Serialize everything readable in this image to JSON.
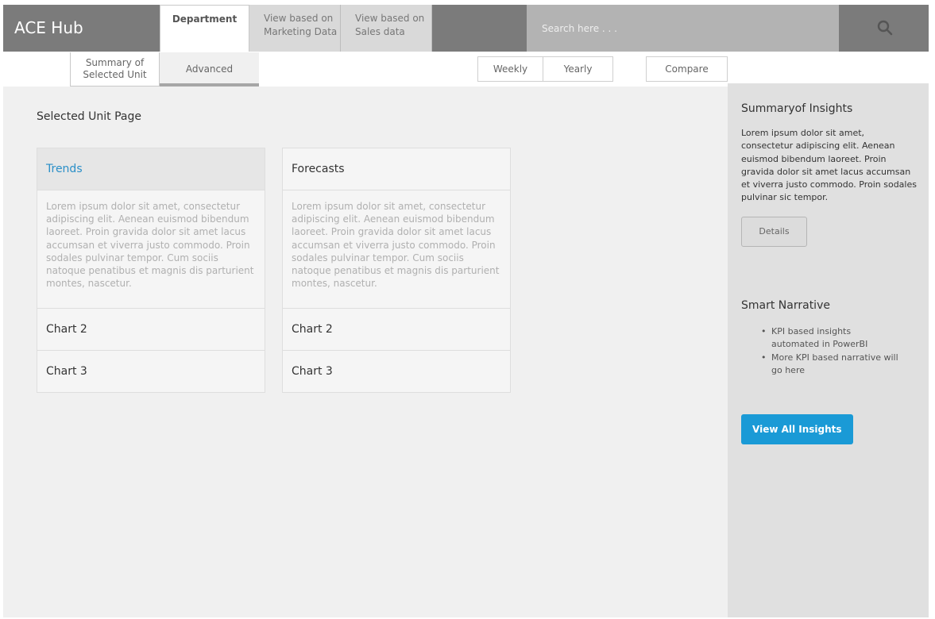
{
  "app": {
    "title": "ACE Hub"
  },
  "tabs": {
    "department": "Department",
    "marketing_line1": "View based on",
    "marketing_line2": "Marketing Data",
    "sales_line1": "View based on",
    "sales_line2": "Sales data"
  },
  "search": {
    "placeholder": "Search here . . ."
  },
  "subtabs": {
    "summary_line1": "Summary of",
    "summary_line2": "Selected Unit",
    "advanced": "Advanced"
  },
  "filters": {
    "weekly": "Weekly",
    "yearly": "Yearly",
    "compare": "Compare"
  },
  "main": {
    "page_title": "Selected Unit Page",
    "cards": [
      {
        "header": "Trends",
        "body": "Lorem ipsum dolor sit amet, consectetur adipiscing elit. Aenean euismod bibendum laoreet. Proin gravida dolor sit amet lacus accumsan et viverra justo commodo. Proin sodales pulvinar tempor. Cum sociis natoque penatibus et magnis dis parturient montes, nascetur.",
        "rows": [
          "Chart 2",
          "Chart 3"
        ]
      },
      {
        "header": "Forecasts",
        "body": "Lorem ipsum dolor sit amet, consectetur adipiscing elit. Aenean euismod bibendum laoreet. Proin gravida dolor sit amet lacus accumsan et viverra justo commodo. Proin sodales pulvinar tempor. Cum sociis natoque penatibus et magnis dis parturient montes, nascetur.",
        "rows": [
          "Chart 2",
          "Chart 3"
        ]
      }
    ]
  },
  "panel": {
    "summary_title": "Summaryof Insights",
    "summary_text": "Lorem ipsum dolor sit amet, consectetur adipiscing elit. Aenean euismod bibendum laoreet. Proin gravida dolor sit amet lacus accumsan et viverra justo commodo. Proin sodales pulvinar sic tempor.",
    "details_label": "Details",
    "narrative_title": "Smart Narrative",
    "narrative_items": [
      "KPI based insights automated in PowerBI",
      "More KPI based narrative will go here"
    ],
    "view_all_label": "View All Insights"
  },
  "colors": {
    "accent": "#1a9ad6",
    "link": "#2a8fc8",
    "topbar_dark": "#7b7b7b",
    "topbar_mid": "#b3b3b3"
  },
  "icons": {
    "search": "search-icon"
  }
}
